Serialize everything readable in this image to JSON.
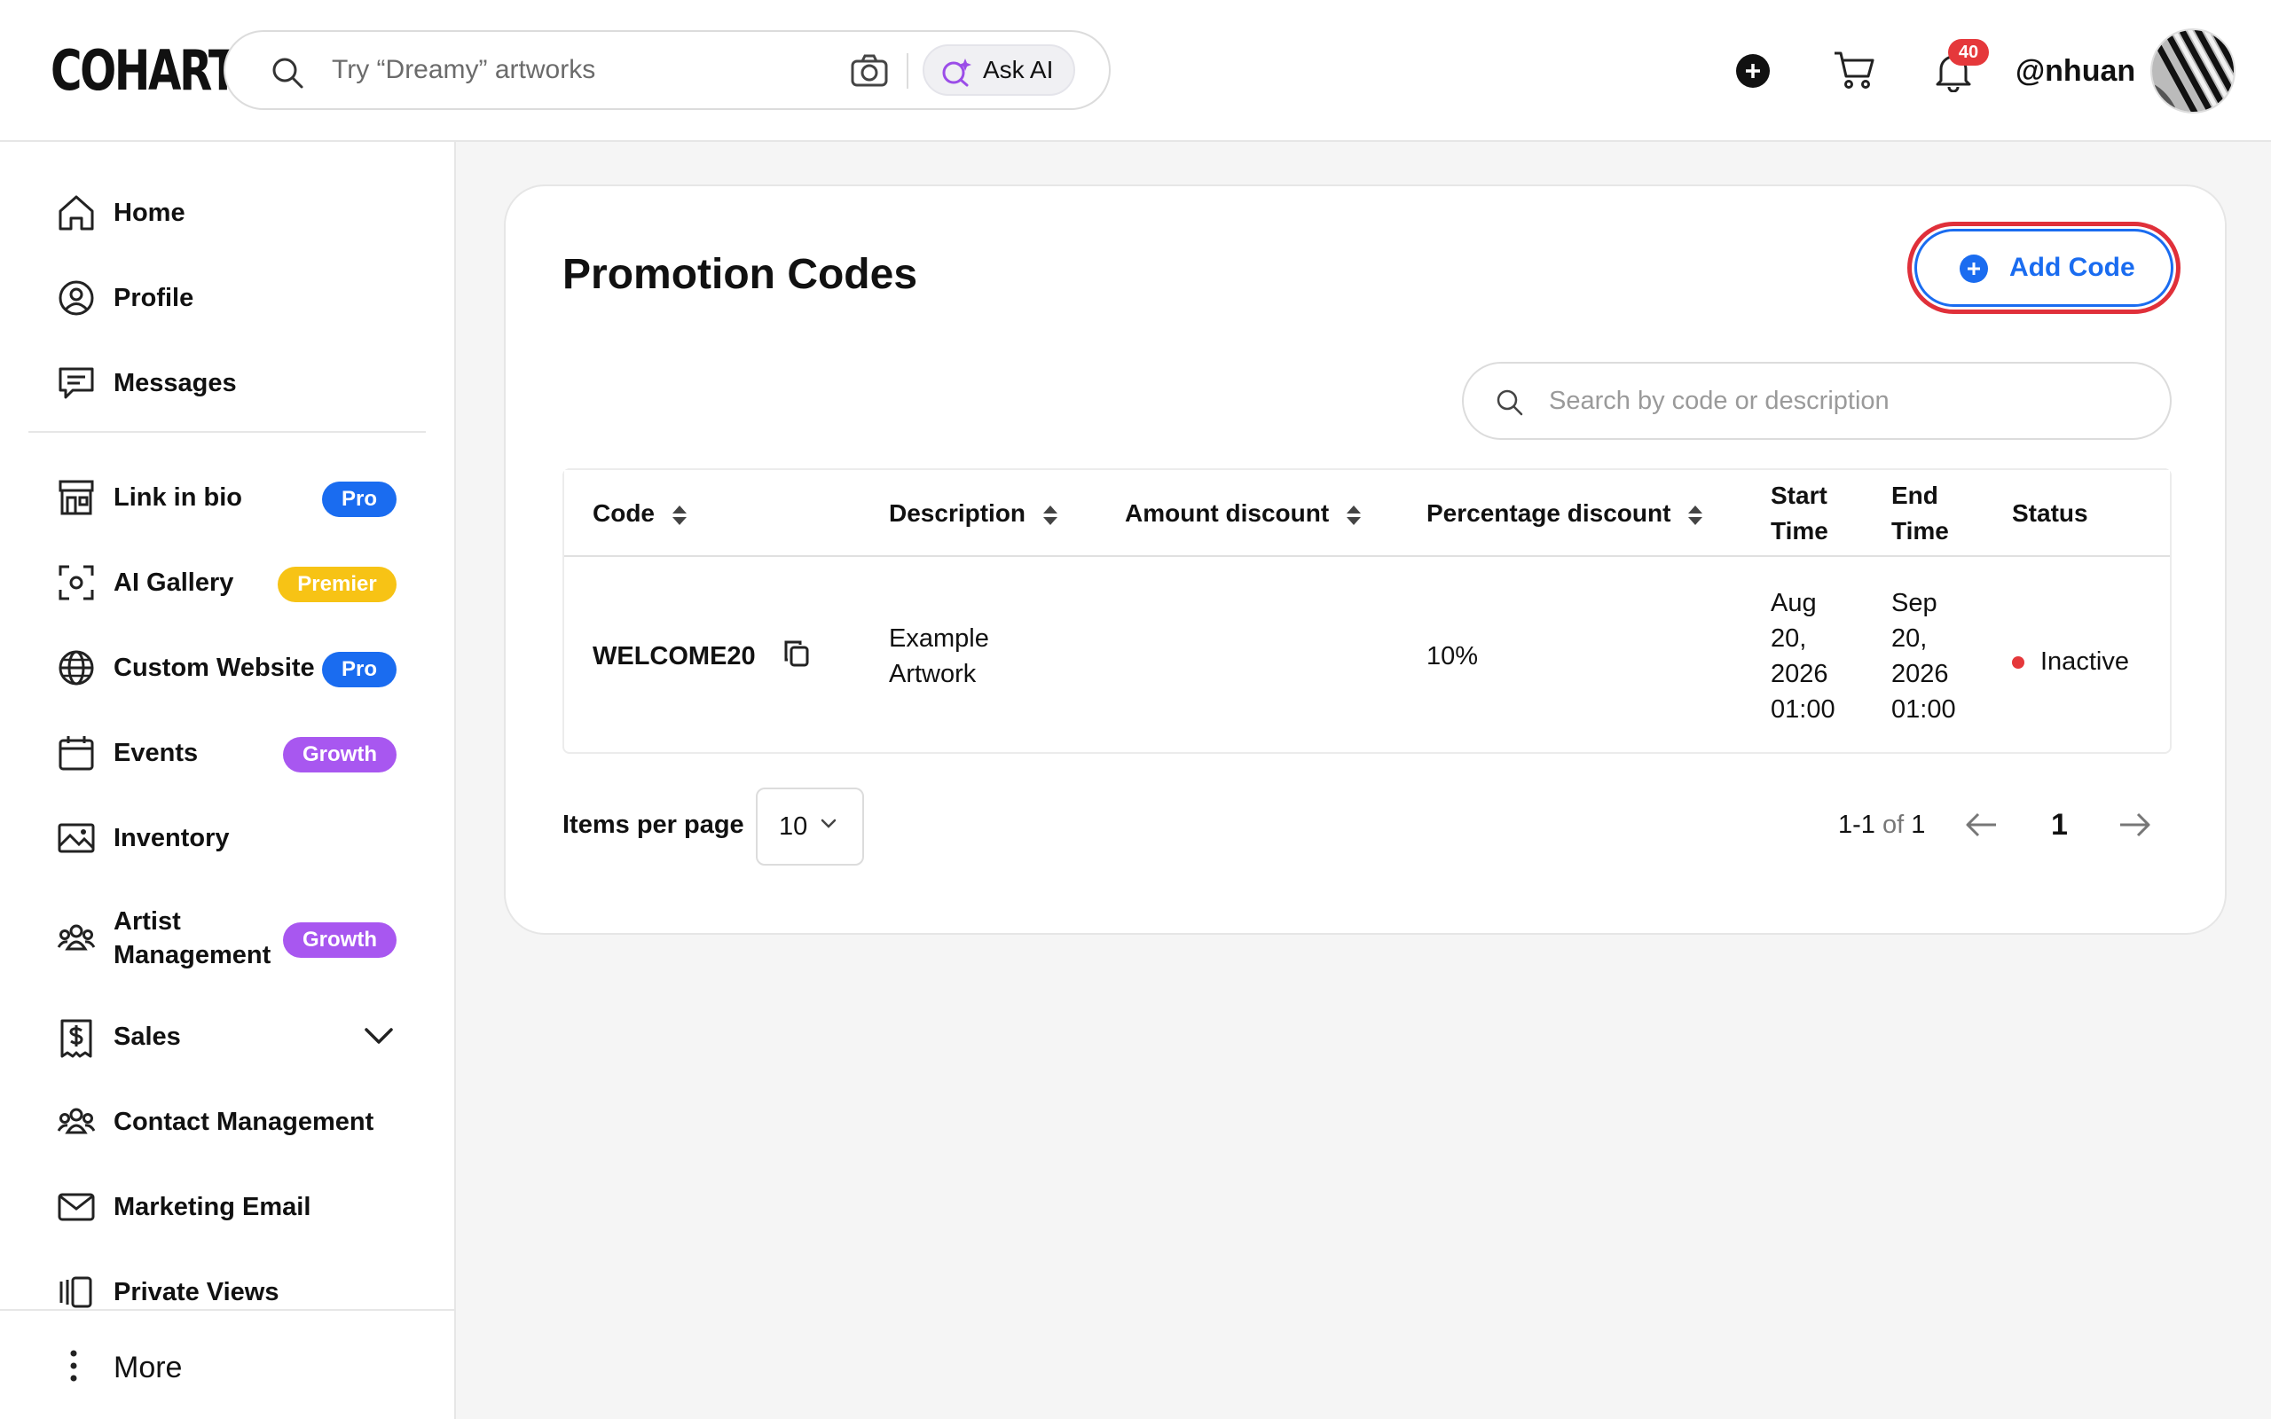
{
  "header": {
    "logo": "COHART",
    "search_placeholder": "Try “Dreamy” artworks",
    "ask_ai_label": "Ask AI",
    "notifications_count": "40",
    "username": "@nhuan"
  },
  "sidebar": {
    "items": [
      {
        "label": "Home",
        "icon": "home-icon"
      },
      {
        "label": "Profile",
        "icon": "profile-icon"
      },
      {
        "label": "Messages",
        "icon": "messages-icon"
      },
      {
        "label": "Link in bio",
        "icon": "storefront-icon",
        "badge": "Pro"
      },
      {
        "label": "AI Gallery",
        "icon": "ai-scan-icon",
        "badge": "Premier"
      },
      {
        "label": "Custom Website",
        "icon": "globe-icon",
        "badge": "Pro"
      },
      {
        "label": "Events",
        "icon": "calendar-icon",
        "badge": "Growth"
      },
      {
        "label": "Inventory",
        "icon": "image-icon"
      },
      {
        "label": "Artist Management",
        "icon": "group-icon",
        "badge": "Growth"
      },
      {
        "label": "Sales",
        "icon": "dollar-receipt-icon"
      },
      {
        "label": "Contact Management",
        "icon": "contacts-icon"
      },
      {
        "label": "Marketing Email",
        "icon": "mail-icon"
      },
      {
        "label": "Private Views",
        "icon": "views-icon"
      }
    ],
    "more_label": "More"
  },
  "main": {
    "title": "Promotion Codes",
    "add_button_label": "Add Code",
    "search_placeholder": "Search by code or description",
    "table": {
      "columns": [
        "Code",
        "Description",
        "Amount discount",
        "Percentage discount",
        "Start Time",
        "End Time",
        "Status"
      ],
      "rows": [
        {
          "code": "WELCOME20",
          "description": "Example Artwork",
          "amount_discount": "",
          "percentage_discount": "10%",
          "start_time": "Aug 20, 2026 01:00",
          "end_time": "Sep 20, 2026 01:00",
          "status": "Inactive"
        }
      ]
    },
    "pagination": {
      "items_per_page_label": "Items per page",
      "items_per_page_value": "10",
      "range": "1-1",
      "of_label": "of",
      "total": "1",
      "current_page": "1"
    }
  },
  "colors": {
    "accent_blue": "#1a6cf0",
    "highlight_red": "#e0303a",
    "badge_premier": "#f7c315",
    "badge_growth": "#a857f0",
    "status_inactive": "#e5383b"
  }
}
